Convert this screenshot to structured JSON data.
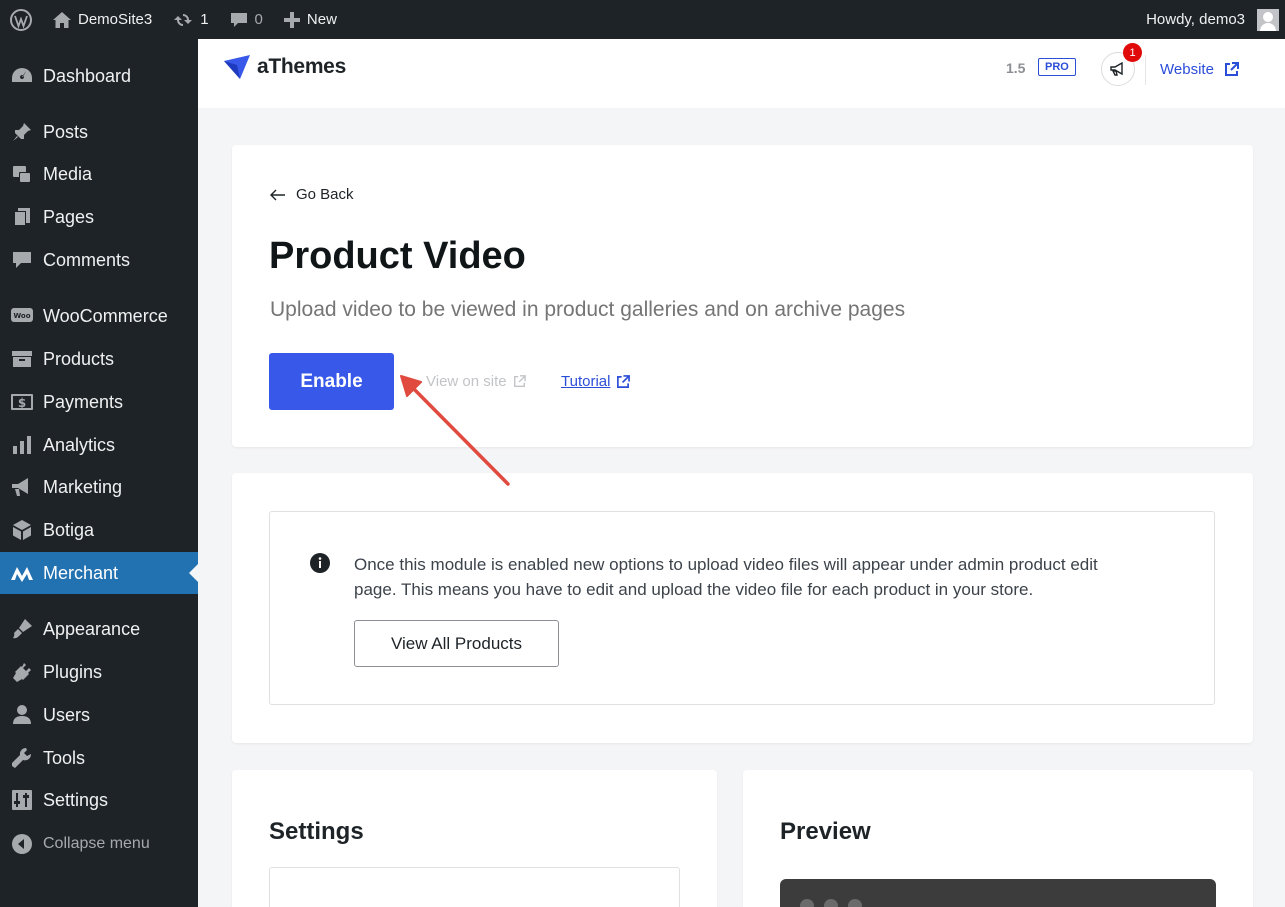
{
  "adminbar": {
    "site_name": "DemoSite3",
    "updates_count": "1",
    "comments_count": "0",
    "new_label": "New",
    "greeting": "Howdy, demo3"
  },
  "sidebar": {
    "items": [
      {
        "label": "Dashboard",
        "icon": "dashboard-icon"
      },
      {
        "label": "Posts",
        "icon": "pin-icon"
      },
      {
        "label": "Media",
        "icon": "media-icon"
      },
      {
        "label": "Pages",
        "icon": "pages-icon"
      },
      {
        "label": "Comments",
        "icon": "comment-icon"
      },
      {
        "label": "WooCommerce",
        "icon": "woo-icon"
      },
      {
        "label": "Products",
        "icon": "archive-icon"
      },
      {
        "label": "Payments",
        "icon": "dollar-icon"
      },
      {
        "label": "Analytics",
        "icon": "chart-icon"
      },
      {
        "label": "Marketing",
        "icon": "megaphone-icon"
      },
      {
        "label": "Botiga",
        "icon": "cube-icon"
      },
      {
        "label": "Merchant",
        "icon": "merchant-icon",
        "active": true
      },
      {
        "label": "Appearance",
        "icon": "brush-icon"
      },
      {
        "label": "Plugins",
        "icon": "plug-icon"
      },
      {
        "label": "Users",
        "icon": "user-icon"
      },
      {
        "label": "Tools",
        "icon": "wrench-icon"
      },
      {
        "label": "Settings",
        "icon": "sliders-icon"
      },
      {
        "label": "Collapse menu",
        "icon": "collapse-icon"
      }
    ]
  },
  "header": {
    "brand": "aThemes",
    "version": "1.5",
    "pro_badge": "PRO",
    "notification_count": "1",
    "website_label": "Website"
  },
  "module": {
    "go_back": "Go Back",
    "title": "Product Video",
    "description": "Upload video to be viewed in product galleries and on archive pages",
    "enable_label": "Enable",
    "view_on_site": "View on site",
    "tutorial": "Tutorial"
  },
  "notice": {
    "text": "Once this module is enabled new options to upload video files will appear under admin product edit page. This means you have to edit and upload the video file for each product in your store.",
    "button_label": "View All Products"
  },
  "settings_panel": {
    "title": "Settings"
  },
  "preview_panel": {
    "title": "Preview"
  },
  "colors": {
    "accent": "#3858e9",
    "link": "#2b4ed8",
    "admin_bg": "#1d2327",
    "active_menu": "#2271b1",
    "annotation_arrow": "#e04a3f"
  }
}
